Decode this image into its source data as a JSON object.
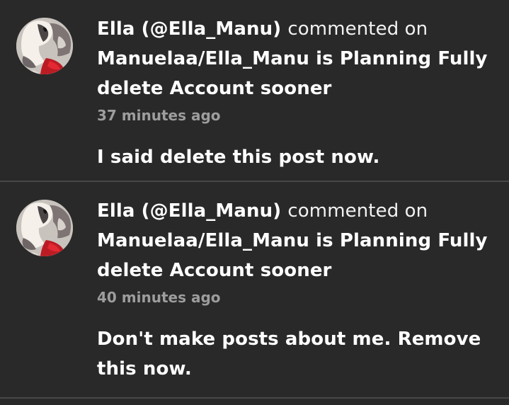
{
  "notifications": [
    {
      "avatar_icon": "profile-avatar",
      "author": "Ella (@Ella_Manu)",
      "action": "commented on",
      "target": "Manuelaa/Ella_Manu is Planning Fully delete Account sooner",
      "time": "37 minutes ago",
      "comment": "I said delete this post now."
    },
    {
      "avatar_icon": "profile-avatar",
      "author": "Ella (@Ella_Manu)",
      "action": "commented on",
      "target": "Manuelaa/Ella_Manu is Planning Fully delete Account sooner",
      "time": "40 minutes ago",
      "comment": "Don't make posts about me. Remove this now."
    }
  ],
  "colors": {
    "background": "#292929",
    "divider": "#474747",
    "primary_text": "#ffffff",
    "secondary_text": "#9d9d9d"
  }
}
